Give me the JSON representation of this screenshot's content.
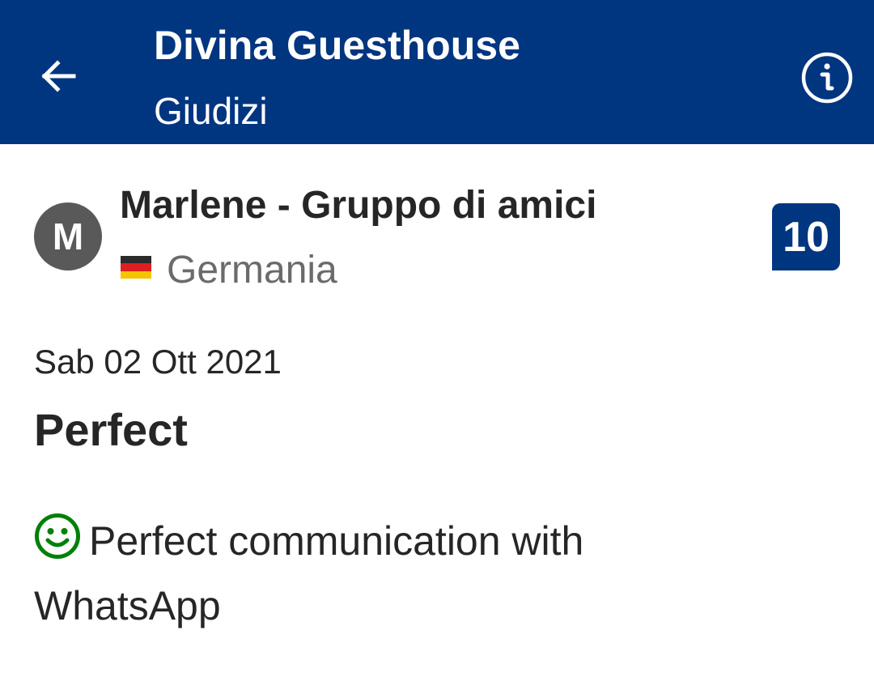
{
  "header": {
    "title": "Divina Guesthouse",
    "subtitle": "Giudizi",
    "back_icon": "arrow-left-icon",
    "info_icon": "info-circle-icon",
    "background_color": "#003580"
  },
  "review": {
    "avatar_initial": "M",
    "reviewer_name": "Marlene - Gruppo di amici",
    "country": "Germania",
    "country_flag_icon": "germany-flag-icon",
    "score": "10",
    "date": "Sab 02 Ott 2021",
    "title": "Perfect",
    "positive_icon": "smiley-face-icon",
    "positive_text": "Perfect communication with WhatsApp",
    "positive_color": "#008009"
  }
}
